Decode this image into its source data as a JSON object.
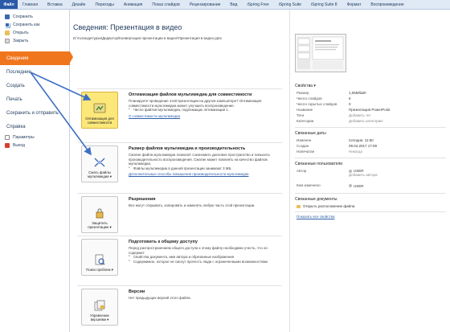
{
  "ribbon": {
    "file_tab": "Файл",
    "tabs": [
      "Главная",
      "Вставка",
      "Дизайн",
      "Переходы",
      "Анимация",
      "Показ слайдов",
      "Рецензирование",
      "Вид",
      "iSpring Free",
      "iSpring Suite",
      "iSpring Suite 8",
      "Формат",
      "Воспроизведение"
    ]
  },
  "sidebar": {
    "small_items": [
      {
        "label": "Сохранить",
        "icon": "save-icon"
      },
      {
        "label": "Сохранить как",
        "icon": "save-as-icon"
      },
      {
        "label": "Открыть",
        "icon": "open-folder-icon"
      },
      {
        "label": "Закрыть",
        "icon": "close-file-icon"
      }
    ],
    "big_items": [
      "Сведения",
      "Последние",
      "Создать",
      "Печать",
      "Сохранить и отправить",
      "Справка"
    ],
    "bottom_items": [
      {
        "label": "Параметры",
        "icon": "options-icon"
      },
      {
        "label": "Выход",
        "icon": "exit-icon"
      }
    ]
  },
  "main": {
    "title": "Сведения: Презентация в видео",
    "path": "D:\\Аспиодетурхи\\Дедвотор\\Конвертация презентации в видео\\Презентация в видео.pptx",
    "sections": [
      {
        "button": "Оптимизация для совместимости",
        "title": "Оптимизация файлов мультимедиа для совместимости",
        "desc": "Планируете проведение этой презентации на другом компьютере? Оптимизация совместимости мультимедиа может улучшить воспроизведение.",
        "bullets": [
          "Число файлов мультимедиа, подлежащих оптимизации 1."
        ],
        "link": "О совместимости мультимедиа"
      },
      {
        "button": "Сжать файлы мультимедиа ▾",
        "title": "Размер файлов мультимедиа и производительность",
        "desc": "Сжатие файла мультимедиа позволит сэкономить дисковое пространство и повысить производительность воспроизведения. Сжатие может повлиять на качество файлов мультимедиа.",
        "bullets": [
          "Файлы мультимедиа в данной презентации занимают 3 МБ."
        ],
        "link": "Дополнительные способы повышения производительности мультимедиа"
      },
      {
        "button": "Защитить презентацию ▾",
        "title": "Разрешения",
        "desc": "Все могут открывать, копировать и изменять любую часть этой презентации.",
        "bullets": [],
        "link": ""
      },
      {
        "button": "Поиск проблем ▾",
        "title": "Подготовить к общему доступу",
        "desc": "Перед распространением общего доступа к этому файлу необходимо учесть, что он содержит:",
        "bullets": [
          "Свойства документа, имя автора и обрезанные изображения",
          "Содержимое, которое не смогут прочесть люди с ограниченными возможностями"
        ],
        "link": ""
      },
      {
        "button": "Управление версиями ▾",
        "title": "Версии",
        "desc": "Нет предыдущих версий этого файла.",
        "bullets": [],
        "link": ""
      }
    ]
  },
  "properties": {
    "header": "Свойства ▾",
    "rows": [
      {
        "k": "Размер",
        "v": "1,06Мбайт",
        "muted": false
      },
      {
        "k": "Число слайдов",
        "v": "6",
        "muted": false
      },
      {
        "k": "Число скрытых слайдов",
        "v": "0",
        "muted": false
      },
      {
        "k": "Название",
        "v": "Презентация PowerPoint",
        "muted": false
      },
      {
        "k": "Теги",
        "v": "Добавить тег",
        "muted": true
      },
      {
        "k": "Категории",
        "v": "Добавить категорию",
        "muted": true
      }
    ],
    "dates_header": "Связанные даты",
    "dates": [
      {
        "k": "Изменен",
        "v": "Сегодня, 11:50",
        "muted": false
      },
      {
        "k": "Создан",
        "v": "09.04.2017 17:09",
        "muted": false
      },
      {
        "k": "Напечатан",
        "v": "Никогда",
        "muted": true
      }
    ],
    "people_header": "Связанные пользователи",
    "people": [
      {
        "k": "Автор",
        "v": "USER",
        "extra": "Добавить автора"
      },
      {
        "k": "Кем изменено",
        "v": "USER",
        "extra": ""
      }
    ],
    "docs_header": "Связанные документы",
    "docs_open": "Открыть расположение файла",
    "show_all": "Показать все свойства"
  },
  "colors": {
    "accent": "#f0761e",
    "file_tab": "#2a5aa8",
    "arrow": "#3d6fc4"
  }
}
